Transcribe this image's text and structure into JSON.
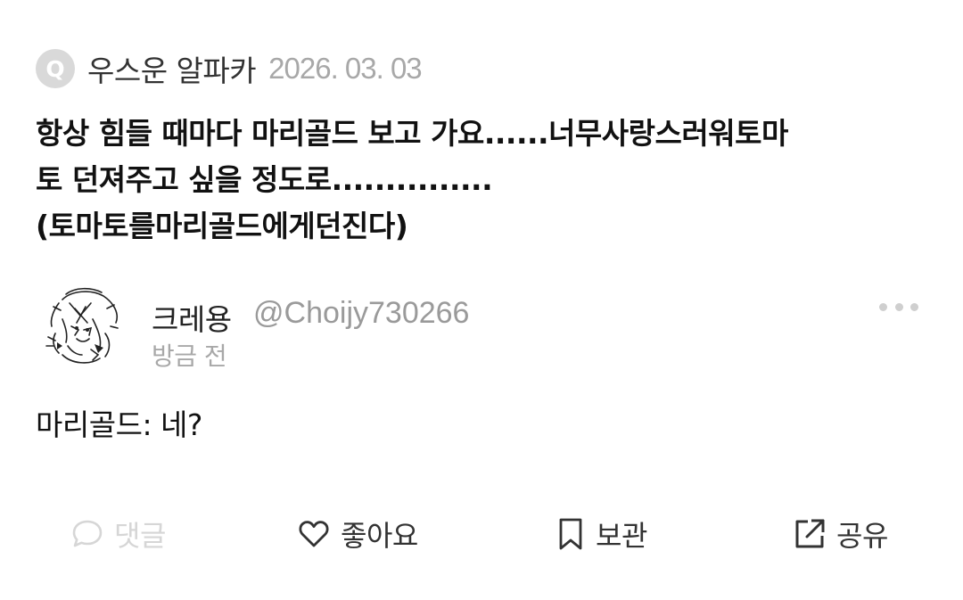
{
  "question": {
    "badge": "Q",
    "asker": "우스운 알파카",
    "date": "2026. 03. 03",
    "text": "항상 힘들 때마다 마리골드 보고 가요......너무사랑스러워토마\n토 던져주고 싶을 정도로...............\n(토마토를마리골드에게던진다)"
  },
  "answer": {
    "name": "크레용",
    "handle": "@Choijy730266",
    "time": "방금 전",
    "text": "마리골드: 네?"
  },
  "actions": {
    "comment": "댓글",
    "like": "좋아요",
    "save": "보관",
    "share": "공유"
  },
  "colors": {
    "muted": "#a8a8a8",
    "disabled": "#d6d6d6",
    "badge": "#d9d9d9"
  },
  "icons": [
    "comment-icon",
    "heart-icon",
    "bookmark-icon",
    "share-icon",
    "more-icon"
  ]
}
